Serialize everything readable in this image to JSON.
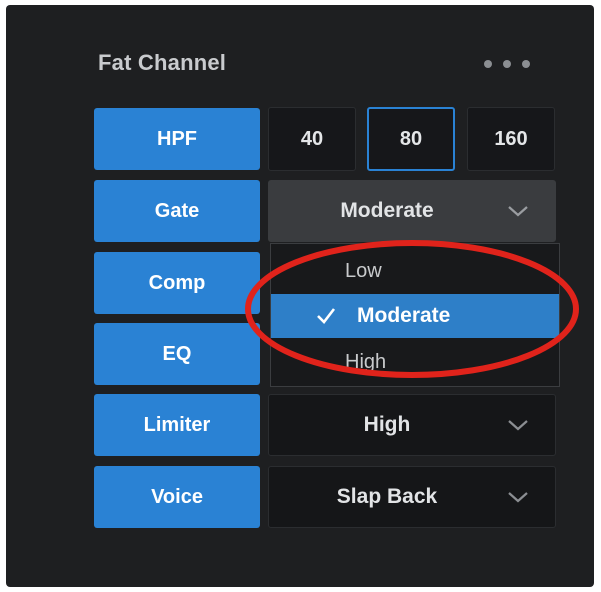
{
  "panel": {
    "title": "Fat Channel"
  },
  "hpf": {
    "label": "HPF",
    "options": [
      "40",
      "80",
      "160"
    ],
    "selected": "80"
  },
  "gate": {
    "label": "Gate",
    "value": "Moderate",
    "dropdown_open": true,
    "options": [
      "Low",
      "Moderate",
      "High"
    ]
  },
  "comp": {
    "label": "Comp"
  },
  "eq": {
    "label": "EQ"
  },
  "limiter": {
    "label": "Limiter",
    "value": "High"
  },
  "voice": {
    "label": "Voice",
    "value": "Slap Back"
  },
  "colors": {
    "accent_blue": "#2a82d4",
    "panel_bg": "#1e1f21",
    "highlight_red": "#e0231b"
  },
  "icons": {
    "more": "more-dots-icon",
    "chevron": "chevron-down-icon",
    "check": "checkmark-icon"
  }
}
